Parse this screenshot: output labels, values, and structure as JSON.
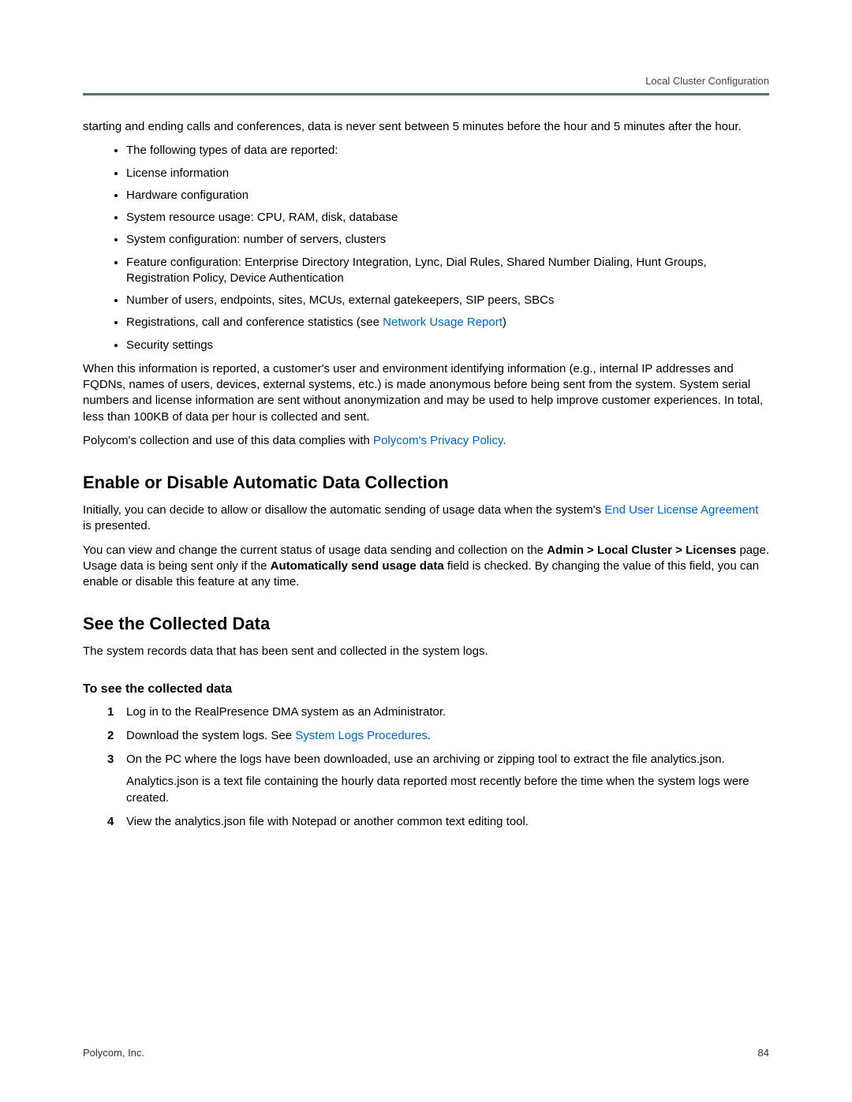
{
  "header": {
    "section": "Local Cluster Configuration"
  },
  "intro_para": "starting and ending calls and conferences, data is never sent between 5 minutes before the hour and 5 minutes after the hour.",
  "bullets": [
    "The following types of data are reported:",
    "License information",
    "Hardware configuration",
    "System resource usage: CPU, RAM, disk, database",
    "System configuration: number of servers, clusters",
    "Feature configuration: Enterprise Directory Integration, Lync, Dial Rules, Shared Number Dialing, Hunt Groups, Registration Policy, Device Authentication",
    "Number of users, endpoints, sites, MCUs, external gatekeepers, SIP peers, SBCs"
  ],
  "bullet_reg_prefix": "Registrations, call and conference statistics (see ",
  "bullet_reg_link": "Network Usage Report",
  "bullet_reg_suffix": ")",
  "bullet_security": "Security settings",
  "para_anonymize": "When this information is reported, a customer's user and environment identifying information (e.g., internal IP addresses and FQDNs, names of users, devices, external systems, etc.) is made anonymous before being sent from the system. System serial numbers and license information are sent without anonymization and may be used to help improve customer experiences. In total, less than 100KB of data per hour is collected and sent.",
  "para_policy_prefix": "Polycom's collection and use of this data complies with ",
  "para_policy_link": "Polycom's Privacy Policy",
  "para_policy_suffix": ".",
  "h2_enable": "Enable or Disable Automatic Data Collection",
  "enable_p1_prefix": "Initially, you can decide to allow or disallow the automatic sending of usage data when the system's ",
  "enable_p1_link": "End User License Agreement",
  "enable_p1_suffix": " is presented.",
  "enable_p2_a": "You can view and change the current status of usage data sending and collection on the ",
  "enable_p2_bold1": "Admin > Local Cluster > Licenses",
  "enable_p2_b": " page. Usage data is being sent only if the ",
  "enable_p2_bold2": "Automatically send usage data",
  "enable_p2_c": " field is checked. By changing the value of this field, you can enable or disable this feature at any time.",
  "h2_see": "See the Collected Data",
  "see_intro": "The system records data that has been sent and collected in the system logs.",
  "h3_tosee": "To see the collected data",
  "step1": "Log in to the RealPresence DMA system as an Administrator.",
  "step2_prefix": "Download the system logs. See ",
  "step2_link": "System Logs Procedures",
  "step2_suffix": ".",
  "step3_a": "On the PC where the logs have been downloaded, use an archiving or zipping tool to extract the file analytics.json.",
  "step3_b": "Analytics.json is a text file containing the hourly data reported most recently before the time when the system logs were created.",
  "step4": "View the analytics.json file with Notepad or another common text editing tool.",
  "footer": {
    "company": "Polycom, Inc.",
    "page": "84"
  }
}
